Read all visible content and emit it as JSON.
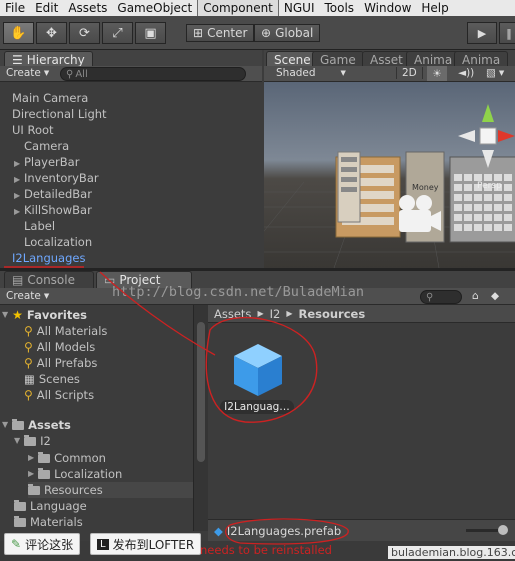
{
  "menu": [
    "File",
    "Edit",
    "Assets",
    "GameObject",
    "Component",
    "NGUI",
    "Tools",
    "Window",
    "Help"
  ],
  "menu_active": "Component",
  "toolbar": {
    "pivot": "Center",
    "space": "Global"
  },
  "hierarchy": {
    "tab": "Hierarchy",
    "create": "Create",
    "search_placeholder": "All",
    "items": [
      {
        "label": "Main Camera",
        "depth": 0,
        "arrow": false
      },
      {
        "label": "Directional Light",
        "depth": 0,
        "arrow": false
      },
      {
        "label": "UI Root",
        "depth": 0,
        "arrow": true
      },
      {
        "label": "Camera",
        "depth": 1,
        "arrow": false
      },
      {
        "label": "PlayerBar",
        "depth": 1,
        "arrow": true
      },
      {
        "label": "InventoryBar",
        "depth": 1,
        "arrow": true
      },
      {
        "label": "DetailedBar",
        "depth": 1,
        "arrow": true
      },
      {
        "label": "KillShowBar",
        "depth": 1,
        "arrow": true
      },
      {
        "label": "Label",
        "depth": 1,
        "arrow": false
      },
      {
        "label": "Localization",
        "depth": 1,
        "arrow": false
      },
      {
        "label": "I2Languages",
        "depth": 0,
        "arrow": false,
        "selected": true
      }
    ]
  },
  "scene": {
    "tabs": [
      "Scene",
      "Game",
      "Asset",
      "Anima",
      "Anima"
    ],
    "shading": "Shaded",
    "mode_2d": "2D",
    "money_label": "Money",
    "persp_label": "Persp"
  },
  "bottom_tabs": [
    "Console",
    "Project"
  ],
  "project": {
    "create": "Create",
    "breadcrumb": [
      "Assets",
      "I2",
      "Resources"
    ],
    "favorites": {
      "label": "Favorites",
      "items": [
        "All Materials",
        "All Models",
        "All Prefabs",
        "Scenes",
        "All Scripts"
      ]
    },
    "tree": [
      {
        "label": "Assets",
        "depth": 0,
        "bold": true
      },
      {
        "label": "I2",
        "depth": 1
      },
      {
        "label": "Common",
        "depth": 2
      },
      {
        "label": "Localization",
        "depth": 2
      },
      {
        "label": "Resources",
        "depth": 2,
        "selected": true
      },
      {
        "label": "Language",
        "depth": 1
      },
      {
        "label": "Materials",
        "depth": 1
      }
    ],
    "asset_label": "I2Languag…",
    "status_file": "I2Languages.prefab"
  },
  "status_message": "needs to be reinstalled",
  "watermark": "http://blog.csdn.net/BuladeMian",
  "footer_site": "bulademian.blog.163.com",
  "share_buttons": [
    "评论这张",
    "发布到LOFTER"
  ],
  "colors": {
    "selected_text": "#6fa8ff",
    "annotation_red": "#cc2222",
    "prefab_blue": "#3d9be9"
  }
}
